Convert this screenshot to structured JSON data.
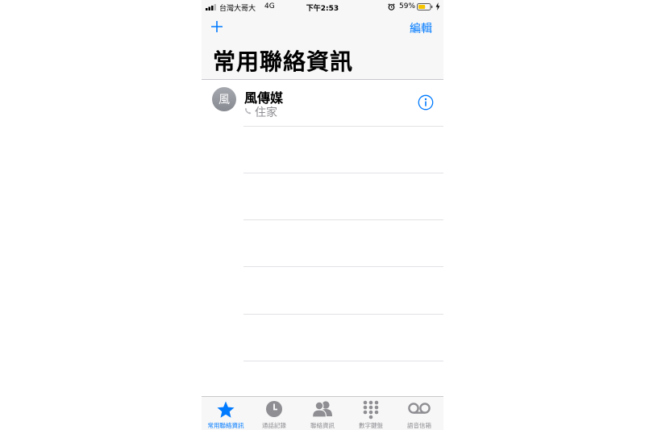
{
  "status_bar": {
    "carrier": "台灣大哥大",
    "network": "4G",
    "time": "下午2:53",
    "battery_percent": "59%",
    "battery_level": 0.59
  },
  "nav": {
    "add_icon": "plus-icon",
    "edit_label": "編輯",
    "title": "常用聯絡資訊"
  },
  "favorites": [
    {
      "avatar": "風",
      "name": "風傳媒",
      "type": "住家"
    }
  ],
  "tabs": [
    {
      "label": "常用聯絡資訊",
      "icon": "star-icon",
      "active": true
    },
    {
      "label": "通話記錄",
      "icon": "clock-icon",
      "active": false
    },
    {
      "label": "聯絡資訊",
      "icon": "contacts-icon",
      "active": false
    },
    {
      "label": "數字鍵盤",
      "icon": "keypad-icon",
      "active": false
    },
    {
      "label": "語音信箱",
      "icon": "voicemail-icon",
      "active": false
    }
  ],
  "colors": {
    "accent": "#007aff",
    "inactive": "#8e8e93",
    "battery": "#f5c400"
  }
}
